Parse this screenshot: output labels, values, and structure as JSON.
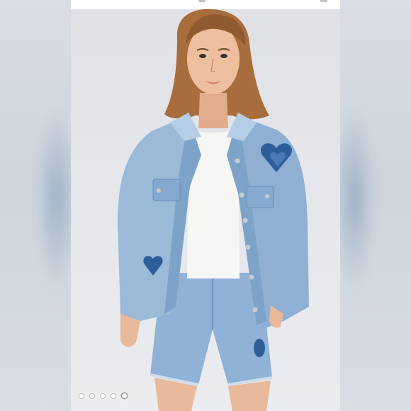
{
  "listing": {
    "favorite_icon": "heart-outline-icon",
    "photo_subject": "denim-jacket-and-shorts-outfit"
  },
  "carousel": {
    "dot_count": 5,
    "active_index": 4
  },
  "colors": {
    "denim_light": "#9bbad8",
    "denim_mid": "#7ea3c9",
    "denim_dark": "#3f6aa0",
    "patch_blue": "#2f5d99",
    "tee_white": "#f6f6f4",
    "skin": "#e8b99a",
    "hair": "#a86d3c",
    "background": "#e3e5e9"
  }
}
